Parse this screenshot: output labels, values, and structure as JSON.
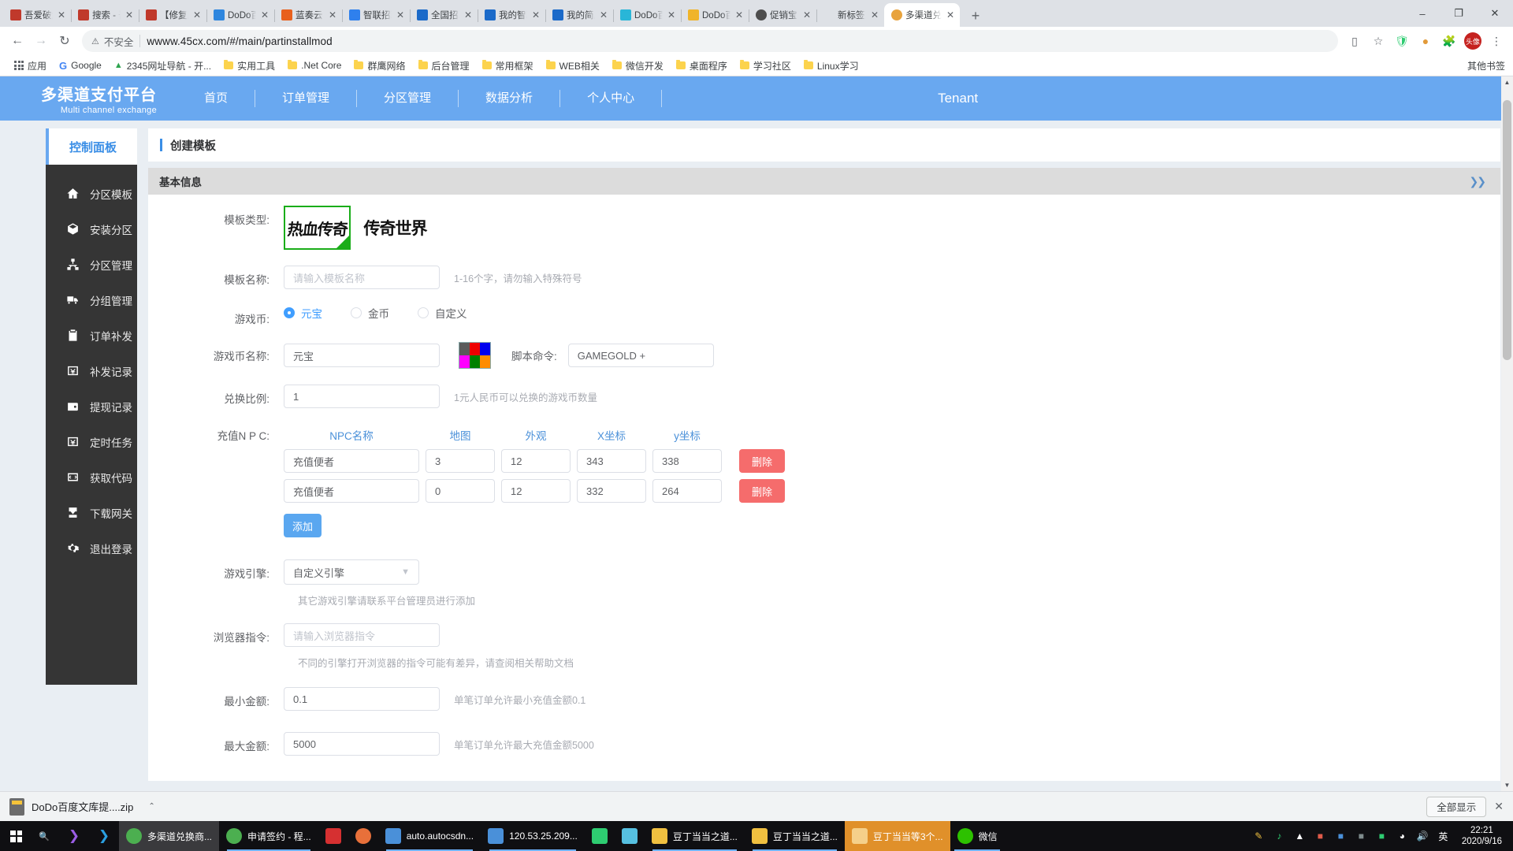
{
  "browser": {
    "tabs": [
      {
        "title": "吾爱破解 -",
        "icon": "seal-red-icon",
        "color": "#c0392b"
      },
      {
        "title": "搜索 - 吾爱",
        "icon": "seal-red-icon",
        "color": "#c0392b"
      },
      {
        "title": "【修复版】",
        "icon": "seal-red-icon",
        "color": "#c0392b"
      },
      {
        "title": "DoDo百度",
        "icon": "baidu-paw-icon",
        "color": "#2e86de"
      },
      {
        "title": "蓝奏云",
        "icon": "lanzou-icon",
        "color": "#e8601c"
      },
      {
        "title": "智联招聘",
        "icon": "zhaopin-icon",
        "color": "#2f80ed"
      },
      {
        "title": "全国招聘网",
        "icon": "globe-icon",
        "color": "#1b6ac9"
      },
      {
        "title": "我的智联",
        "icon": "zhilian-icon",
        "color": "#1b6ac9"
      },
      {
        "title": "我的简历",
        "icon": "zhilian-icon",
        "color": "#1b6ac9"
      },
      {
        "title": "DoDo百度",
        "icon": "robot-icon",
        "color": "#29b6d8"
      },
      {
        "title": "DoDo百度",
        "icon": "flame-icon",
        "color": "#f0b429"
      },
      {
        "title": "促销宝",
        "icon": "globe-dark-icon",
        "color": "#4d4d4d"
      },
      {
        "title": "新标签页",
        "icon": "blank-icon",
        "color": "#ffffff"
      },
      {
        "title": "多渠道兑换",
        "icon": "coin-icon",
        "color": "#e8a33d",
        "active": true
      }
    ],
    "new_tab_label": "+",
    "window_controls": {
      "minimize": "–",
      "maximize": "❐",
      "close": "✕"
    },
    "nav": {
      "back": "←",
      "forward": "→",
      "reload": "↻"
    },
    "omnibox": {
      "security_icon": "not-secure-warning-icon",
      "security_text": "不安全",
      "url": "wwww.45cx.com/#/main/partinstallmod"
    },
    "toolbar_icons": [
      "translate-icon",
      "bookmark-star-icon",
      "shield-icon",
      "extension-puzzle-icon",
      "cookie-icon",
      "menu-kebab-icon"
    ],
    "avatar_initials": "头像",
    "bookmarks": [
      {
        "label": "应用",
        "icon": "apps-grid-icon"
      },
      {
        "label": "Google",
        "icon": "google-g-icon"
      },
      {
        "label": "2345网址导航 - 开...",
        "icon": "2345-icon"
      },
      {
        "label": "实用工具",
        "icon": "folder-icon"
      },
      {
        "label": ".Net Core",
        "icon": "folder-icon"
      },
      {
        "label": "群鹰网络",
        "icon": "folder-icon"
      },
      {
        "label": "后台管理",
        "icon": "folder-icon"
      },
      {
        "label": "常用框架",
        "icon": "folder-icon"
      },
      {
        "label": "WEB相关",
        "icon": "folder-icon"
      },
      {
        "label": "微信开发",
        "icon": "folder-icon"
      },
      {
        "label": "桌面程序",
        "icon": "folder-icon"
      },
      {
        "label": "学习社区",
        "icon": "folder-icon"
      },
      {
        "label": "Linux学习",
        "icon": "folder-icon"
      }
    ],
    "bookmarks_overflow": "其他书签"
  },
  "app": {
    "brand_cn": "多渠道支付平台",
    "brand_en": "Multi channel exchange",
    "nav_items": [
      "首页",
      "订单管理",
      "分区管理",
      "数据分析",
      "个人中心"
    ],
    "tenant": "Tenant",
    "accent_color": "#69a8f0"
  },
  "sidebar": {
    "panel_label": "控制面板",
    "items": [
      {
        "label": "分区模板",
        "icon": "home-icon"
      },
      {
        "label": "安装分区",
        "icon": "box-icon"
      },
      {
        "label": "分区管理",
        "icon": "sitemap-icon"
      },
      {
        "label": "分组管理",
        "icon": "truck-icon"
      },
      {
        "label": "订单补发",
        "icon": "clipboard-icon"
      },
      {
        "label": "补发记录",
        "icon": "yuan-box-icon"
      },
      {
        "label": "提现记录",
        "icon": "wallet-icon"
      },
      {
        "label": "定时任务",
        "icon": "yuan-box-icon"
      },
      {
        "label": "获取代码",
        "icon": "code-icon"
      },
      {
        "label": "下载网关",
        "icon": "download-icon"
      },
      {
        "label": "退出登录",
        "icon": "gear-icon"
      }
    ]
  },
  "page": {
    "title": "创建模板",
    "section_title": "基本信息",
    "collapse_icon": "chevron-double-down-icon",
    "template_type": {
      "label": "模板类型:",
      "options": [
        {
          "name": "热血传奇",
          "selected": true
        },
        {
          "name": "传奇世界",
          "selected": false
        }
      ]
    },
    "template_name": {
      "label": "模板名称:",
      "value": "",
      "placeholder": "请输入模板名称",
      "hint": "1-16个字，请勿输入特殊符号"
    },
    "currency": {
      "label": "游戏币:",
      "options": [
        "元宝",
        "金币",
        "自定义"
      ],
      "selected": "元宝"
    },
    "currency_name": {
      "label": "游戏币名称:",
      "value": "元宝",
      "swatch_colors": [
        "#5a5a5a",
        "#ee0000",
        "#0000ee",
        "#ff00ff",
        "#008000",
        "#ff8c00"
      ]
    },
    "script_command": {
      "label": "脚本命令:",
      "value": "GAMEGOLD +"
    },
    "exchange_rate": {
      "label": "兑换比例:",
      "value": "1",
      "hint": "1元人民币可以兑换的游戏币数量"
    },
    "npc": {
      "label": "充值N P C:",
      "columns": [
        "NPC名称",
        "地图",
        "外观",
        "X坐标",
        "y坐标"
      ],
      "rows": [
        {
          "name": "充值便者",
          "map": "3",
          "appearance": "12",
          "x": "343",
          "y": "338",
          "delete_label": "删除"
        },
        {
          "name": "充值便者",
          "map": "0",
          "appearance": "12",
          "x": "332",
          "y": "264",
          "delete_label": "删除"
        }
      ],
      "add_label": "添加"
    },
    "engine": {
      "label": "游戏引擎:",
      "value": "自定义引擎",
      "hint": "其它游戏引擎请联系平台管理员进行添加"
    },
    "browser_cmd": {
      "label": "浏览器指令:",
      "value": "",
      "placeholder": "请输入浏览器指令",
      "hint": "不同的引擎打开浏览器的指令可能有差异，请查阅相关帮助文档"
    },
    "min_amount": {
      "label": "最小金额:",
      "value": "0.1",
      "hint": "单笔订单允许最小充值金额0.1"
    },
    "max_amount": {
      "label": "最大金额:",
      "value": "5000",
      "hint": "单笔订单允许最大充值金额5000"
    }
  },
  "download_bar": {
    "file_name": "DoDo百度文库提....zip",
    "caret": "⌃",
    "show_all_label": "全部显示",
    "close_label": "✕"
  },
  "taskbar": {
    "start_icon": "windows-start-icon",
    "search_icon": "search-icon",
    "items": [
      {
        "label": "",
        "icon": "vscode-insiders-icon",
        "color": "#9b5de5",
        "state": "pinned"
      },
      {
        "label": "",
        "icon": "vscode-icon",
        "color": "#2b9fe0",
        "state": "pinned"
      },
      {
        "label": "多渠道兑换商...",
        "icon": "chrome-icon",
        "color": "#4caf50",
        "state": "active"
      },
      {
        "label": "申请签约 - 程...",
        "icon": "chrome-icon",
        "color": "#4caf50",
        "state": "running"
      },
      {
        "label": "",
        "icon": "red-app-icon",
        "color": "#d63031",
        "state": "pinned"
      },
      {
        "label": "",
        "icon": "firefox-icon",
        "color": "#e8703a",
        "state": "pinned"
      },
      {
        "label": "auto.autocsdn...",
        "icon": "explorer-icon",
        "color": "#4a90d9",
        "state": "running"
      },
      {
        "label": "120.53.25.209...",
        "icon": "explorer-icon",
        "color": "#4a90d9",
        "state": "running"
      },
      {
        "label": "",
        "icon": "notepad-icon",
        "color": "#2ecc71",
        "state": "pinned"
      },
      {
        "label": "",
        "icon": "bird-app-icon",
        "color": "#56c0e0",
        "state": "pinned"
      },
      {
        "label": "豆丁当当之道...",
        "icon": "folder-yellow-icon",
        "color": "#f0c040",
        "state": "running"
      },
      {
        "label": "豆丁当当之道...",
        "icon": "folder-yellow-icon",
        "color": "#f0c040",
        "state": "running"
      },
      {
        "label": "豆丁当当等3个...",
        "icon": "folder-orange-icon",
        "color": "#e0902a",
        "state": "accent"
      },
      {
        "label": "微信",
        "icon": "wechat-icon",
        "color": "#2dc100",
        "state": "running"
      }
    ],
    "tray_icons": [
      "pen-icon",
      "ear-icon",
      "arrow-up-icon",
      "shield-icon",
      "app-icon-1",
      "app-icon-2",
      "app-icon-3",
      "app-icon-4",
      "network-icon",
      "volume-icon"
    ],
    "ime_label": "英",
    "clock_time": "22:21",
    "clock_date": "2020/9/16"
  }
}
